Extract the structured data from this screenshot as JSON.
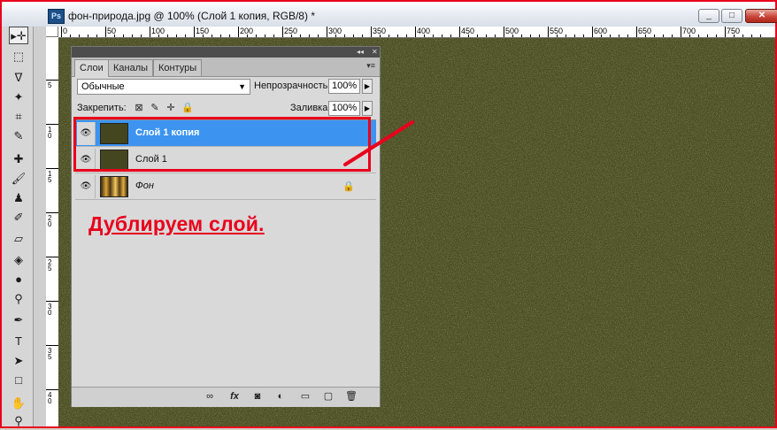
{
  "window": {
    "app_badge": "Ps",
    "title": "фон-природа.jpg @ 100% (Слой 1 копия, RGB/8) *",
    "minimize": "_",
    "maximize": "□",
    "close": "✕"
  },
  "ruler": {
    "labels": [
      "0",
      "50",
      "100",
      "150",
      "200",
      "250",
      "300",
      "350",
      "400",
      "450",
      "500",
      "550",
      "600",
      "650",
      "700",
      "750"
    ],
    "vertical_labels": [
      "5",
      "1 0",
      "1 5",
      "2 0",
      "2 5",
      "3 0",
      "3 5",
      "4 0"
    ]
  },
  "panel": {
    "top_arrows": "◂◂",
    "top_close": "✕",
    "tabs": [
      {
        "label": "Слои",
        "active": true
      },
      {
        "label": "Каналы",
        "active": false
      },
      {
        "label": "Контуры",
        "active": false
      }
    ],
    "menu_icon": "▾≡",
    "blend_mode": "Обычные",
    "opacity_label": "Непрозрачность:",
    "opacity_value": "100%",
    "lock_label": "Закрепить:",
    "fill_label": "Заливка:",
    "fill_value": "100%",
    "layers": [
      {
        "name": "Слой 1 копия",
        "selected": true,
        "visible": true
      },
      {
        "name": "Слой 1",
        "selected": false,
        "visible": true
      },
      {
        "name": "Фон",
        "selected": false,
        "visible": true,
        "locked": true
      }
    ]
  },
  "annotation": {
    "text": "Дублируем слой.",
    "color": "#e8001c"
  },
  "colors": {
    "selected_layer": "#3c94f0",
    "texture": "#424320",
    "frame": "#e8001c"
  }
}
